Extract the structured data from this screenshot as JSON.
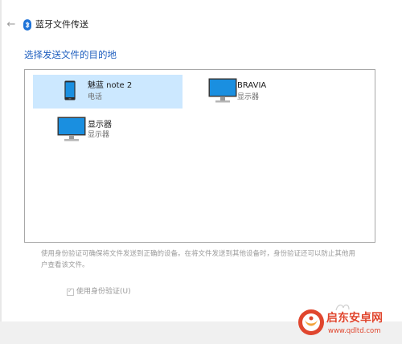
{
  "window": {
    "title": "蓝牙文件传送",
    "back_glyph": "←"
  },
  "heading": "选择发送文件的目的地",
  "devices": [
    {
      "name": "魅蓝 note 2",
      "type": "电话",
      "icon": "phone-icon",
      "selected": true
    },
    {
      "name": "BRAVIA",
      "type": "显示器",
      "icon": "monitor-icon",
      "selected": false
    },
    {
      "name": "显示器",
      "type": "显示器",
      "icon": "monitor-icon",
      "selected": false
    }
  ],
  "info_text": "使用身份验证可确保将文件发送到正确的设备。在将文件发送到其他设备时，身份验证还可以防止其他用户查看该文件。",
  "auth_checkbox": {
    "label": "使用身份验证(U)",
    "checked": true,
    "disabled": true
  },
  "watermark": {
    "name": "启东安卓网",
    "url": "www.qdltd.com"
  },
  "colors": {
    "accent": "#1f5fbf",
    "selected_bg": "#cce8ff",
    "bluetooth": "#1e73d8",
    "watermark": "#e0462e"
  }
}
